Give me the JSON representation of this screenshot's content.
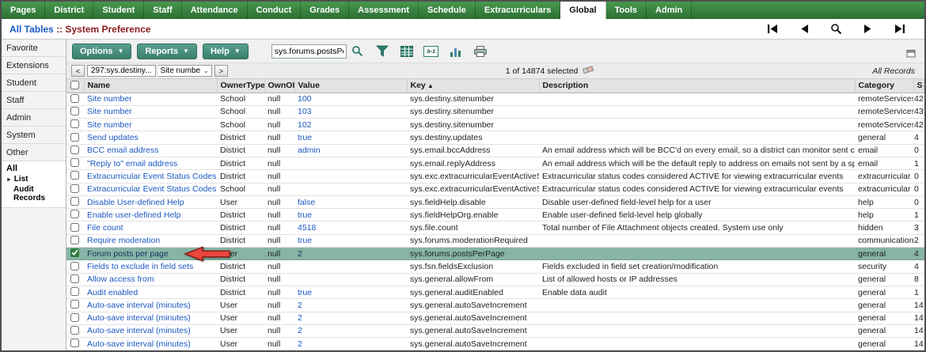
{
  "nav": {
    "tabs": [
      {
        "label": "Pages",
        "active": false
      },
      {
        "label": "District",
        "active": false
      },
      {
        "label": "Student",
        "active": false
      },
      {
        "label": "Staff",
        "active": false
      },
      {
        "label": "Attendance",
        "active": false
      },
      {
        "label": "Conduct",
        "active": false
      },
      {
        "label": "Grades",
        "active": false
      },
      {
        "label": "Assessment",
        "active": false
      },
      {
        "label": "Schedule",
        "active": false
      },
      {
        "label": "Extracurriculars",
        "active": false
      },
      {
        "label": "Global",
        "active": true
      },
      {
        "label": "Tools",
        "active": false
      },
      {
        "label": "Admin",
        "active": false
      }
    ]
  },
  "breadcrumb": {
    "link_label": "All Tables",
    "separator": "::",
    "current_label": "System Preference"
  },
  "icons": {
    "first_record": "skip-to-first triangle-with-bar",
    "previous_record": "left triangle",
    "find": "magnifier",
    "next_record": "right triangle",
    "last_record": "skip-to-last triangle-with-bar",
    "filter": "funnel",
    "field_set": "grid",
    "sort": "a-z",
    "quick_chart": "bar-chart",
    "print": "printer",
    "clear_selection": "eraser",
    "popout": "window",
    "annotation": "red-left-arrow"
  },
  "colors": {
    "nav_green": "#2b6e33",
    "active_tab_bg": "#ffffff",
    "breadcrumb_maroon": "#8b1a1a",
    "link_blue": "#1b58c2",
    "button_teal": "#3a7f6e",
    "selected_row_green": "#86b4a6",
    "arrow_red": "#e8473e"
  },
  "sidebar": {
    "items": [
      "Favorite",
      "Extensions",
      "Student",
      "Staff",
      "Admin",
      "System",
      "Other"
    ],
    "all_section": {
      "label": "All",
      "children": [
        "List",
        "Audit Records"
      ]
    }
  },
  "toolbar": {
    "options_label": "Options",
    "reports_label": "Reports",
    "help_label": "Help",
    "search_value": "sys.forums.postsPerF",
    "az_icon_label": "a-z"
  },
  "recordbar": {
    "prev_label": "<",
    "record_value": "297:sys.destiny...",
    "view_value": "Site numbe",
    "next_label": ">",
    "selection_text": "1 of 14874 selected",
    "all_records_label": "All Records"
  },
  "table": {
    "headers": [
      "Name",
      "OwnerType",
      "OwnOID",
      "Value",
      "Key",
      "Description",
      "Category",
      "S"
    ],
    "sorted_by": "Key",
    "sort_arrow": "▲",
    "rows": [
      {
        "name": "Site number",
        "owner": "School",
        "ownoid": "null",
        "value": "100",
        "key": "sys.destiny.sitenumber",
        "desc": "",
        "category": "remoteServices",
        "seq": "42"
      },
      {
        "name": "Site number",
        "owner": "School",
        "ownoid": "null",
        "value": "103",
        "key": "sys.destiny.sitenumber",
        "desc": "",
        "category": "remoteServices",
        "seq": "43"
      },
      {
        "name": "Site number",
        "owner": "School",
        "ownoid": "null",
        "value": "102",
        "key": "sys.destiny.sitenumber",
        "desc": "",
        "category": "remoteServices",
        "seq": "42"
      },
      {
        "name": "Send updates",
        "owner": "District",
        "ownoid": "null",
        "value": "true",
        "key": "sys.destiny.updates",
        "desc": "",
        "category": "general",
        "seq": "4"
      },
      {
        "name": "BCC email address",
        "owner": "District",
        "ownoid": "null",
        "value": "admin",
        "key": "sys.email.bccAddress",
        "desc": "An email address which will be BCC'd on every email, so a district can monitor sent communications.",
        "category": "email",
        "seq": "0"
      },
      {
        "name": "\"Reply to\" email address",
        "owner": "District",
        "ownoid": "null",
        "value": "",
        "key": "sys.email.replyAddress",
        "desc": "An email address which will be the default reply to address on emails not sent by a specific user",
        "category": "email",
        "seq": "1"
      },
      {
        "name": "Extracurricular Event Status Codes",
        "owner": "District",
        "ownoid": "null",
        "value": "",
        "key": "sys.exc.extracurricularEventActiveStatus",
        "desc": "Extracurricular status codes considered ACTIVE for viewing extracurricular events",
        "category": "extracurricular",
        "seq": "0"
      },
      {
        "name": "Extracurricular Event Status Codes",
        "owner": "School",
        "ownoid": "null",
        "value": "",
        "key": "sys.exc.extracurricularEventActiveStatus",
        "desc": "Extracurricular status codes considered ACTIVE for viewing extracurricular events",
        "category": "extracurricular",
        "seq": "0"
      },
      {
        "name": "Disable User-defined Help",
        "owner": "User",
        "ownoid": "null",
        "value": "false",
        "key": "sys.fieldHelp.disable",
        "desc": "Disable user-defined field-level help for a user",
        "category": "help",
        "seq": "0"
      },
      {
        "name": "Enable user-defined Help",
        "owner": "District",
        "ownoid": "null",
        "value": "true",
        "key": "sys.fieldHelpOrg.enable",
        "desc": "Enable user-defined field-level help globally",
        "category": "help",
        "seq": "1"
      },
      {
        "name": "File count",
        "owner": "District",
        "ownoid": "null",
        "value": "4518",
        "key": "sys.file.count",
        "desc": "Total number of File Attachment objects created. System use only",
        "category": "hidden",
        "seq": "3"
      },
      {
        "name": "Require moderation",
        "owner": "District",
        "ownoid": "null",
        "value": "true",
        "key": "sys.forums.moderationRequired",
        "desc": "",
        "category": "communication",
        "seq": "2"
      },
      {
        "name": "Forum posts per page",
        "owner": "User",
        "ownoid": "null",
        "value": "2",
        "key": "sys.forums.postsPerPage",
        "desc": "",
        "category": "general",
        "seq": "4",
        "selected": true,
        "checked": true
      },
      {
        "name": "Fields to exclude in field sets",
        "owner": "District",
        "ownoid": "null",
        "value": "",
        "key": "sys.fsn.fieldsExclusion",
        "desc": "Fields excluded in field set creation/modification",
        "category": "security",
        "seq": "4"
      },
      {
        "name": "Allow access from",
        "owner": "District",
        "ownoid": "null",
        "value": "",
        "key": "sys.general.allowFrom",
        "desc": "List of allowed hosts or IP addresses",
        "category": "general",
        "seq": "8"
      },
      {
        "name": "Audit enabled",
        "owner": "District",
        "ownoid": "null",
        "value": "true",
        "key": "sys.general.auditEnabled",
        "desc": "Enable data audit",
        "category": "general",
        "seq": "1"
      },
      {
        "name": "Auto-save interval (minutes)",
        "owner": "User",
        "ownoid": "null",
        "value": "2",
        "key": "sys.general.autoSaveIncrement",
        "desc": "",
        "category": "general",
        "seq": "14"
      },
      {
        "name": "Auto-save interval (minutes)",
        "owner": "User",
        "ownoid": "null",
        "value": "2",
        "key": "sys.general.autoSaveIncrement",
        "desc": "",
        "category": "general",
        "seq": "14"
      },
      {
        "name": "Auto-save interval (minutes)",
        "owner": "User",
        "ownoid": "null",
        "value": "2",
        "key": "sys.general.autoSaveIncrement",
        "desc": "",
        "category": "general",
        "seq": "14"
      },
      {
        "name": "Auto-save interval (minutes)",
        "owner": "User",
        "ownoid": "null",
        "value": "2",
        "key": "sys.general.autoSaveIncrement",
        "desc": "",
        "category": "general",
        "seq": "14"
      }
    ]
  }
}
